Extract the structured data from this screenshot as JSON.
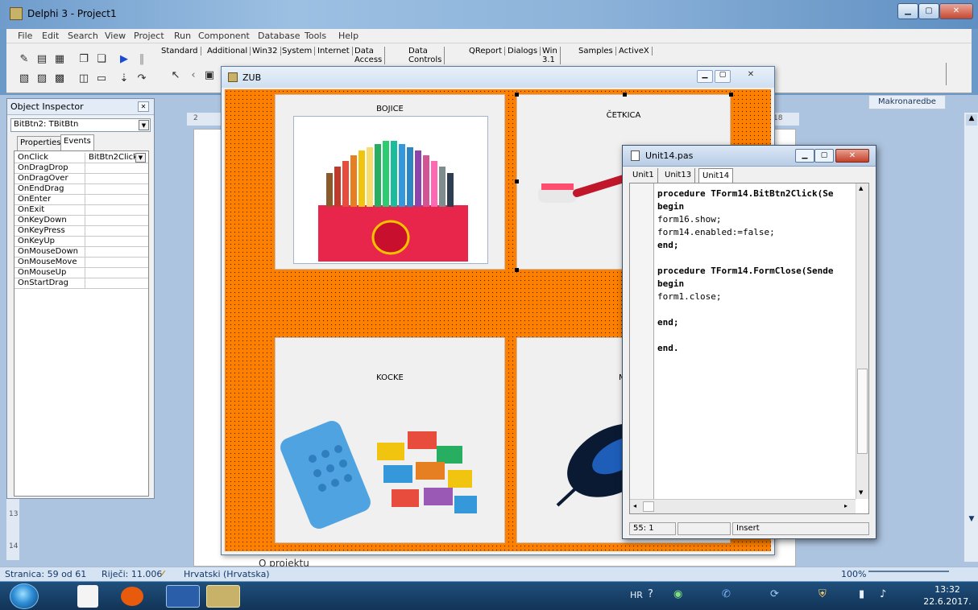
{
  "main_window": {
    "title": "Delphi 3 - Project1",
    "menu": [
      "File",
      "Edit",
      "Search",
      "View",
      "Project",
      "Run",
      "Component",
      "Database",
      "Tools",
      "Help"
    ],
    "palette_tabs": [
      "Standard",
      "Additional",
      "Win32",
      "System",
      "Internet",
      "Data Access",
      "Data Controls",
      "QReport",
      "Dialogs",
      "Win 3.1",
      "Samples",
      "ActiveX"
    ]
  },
  "word": {
    "makro_label": "Makronaredbe",
    "page_text": "O projektu",
    "ruler_left_num": "2",
    "ruler_right_num": "18",
    "ruler_left_vertical": [
      "13",
      "14"
    ],
    "status": {
      "page": "Stranica: 59 od 61",
      "words": "Riječi: 11.006",
      "language": "Hrvatski (Hrvatska)",
      "zoom": "100%"
    }
  },
  "object_inspector": {
    "title": "Object Inspector",
    "component": "BitBtn2: TBitBtn",
    "tabs": [
      "Properties",
      "Events"
    ],
    "active_tab": "Events",
    "events": [
      {
        "name": "OnClick",
        "value": "BitBtn2Click"
      },
      {
        "name": "OnDragDrop",
        "value": ""
      },
      {
        "name": "OnDragOver",
        "value": ""
      },
      {
        "name": "OnEndDrag",
        "value": ""
      },
      {
        "name": "OnEnter",
        "value": ""
      },
      {
        "name": "OnExit",
        "value": ""
      },
      {
        "name": "OnKeyDown",
        "value": ""
      },
      {
        "name": "OnKeyPress",
        "value": ""
      },
      {
        "name": "OnKeyUp",
        "value": ""
      },
      {
        "name": "OnMouseDown",
        "value": ""
      },
      {
        "name": "OnMouseMove",
        "value": ""
      },
      {
        "name": "OnMouseUp",
        "value": ""
      },
      {
        "name": "OnStartDrag",
        "value": ""
      }
    ]
  },
  "zub_form": {
    "title": "ZUB",
    "panels": [
      {
        "caption": "BOJICE"
      },
      {
        "caption": "ČETKICA"
      },
      {
        "caption": "KOCKE"
      },
      {
        "caption": "M"
      }
    ]
  },
  "editor": {
    "title": "Unit14.pas",
    "tabs": [
      "Unit1",
      "Unit13",
      "Unit14"
    ],
    "active_tab": "Unit14",
    "lines": [
      "procedure TForm14.BitBtn2Click(Se",
      "begin",
      "form16.show;",
      "form14.enabled:=false;",
      "end;",
      "",
      "procedure TForm14.FormClose(Sende",
      "begin",
      "form1.close;",
      "",
      "end;",
      "",
      "end."
    ],
    "status": {
      "position": "55:  1",
      "mode": "Insert"
    }
  },
  "taskbar": {
    "lang": "HR",
    "time": "13:32",
    "date": "22.6.2017."
  },
  "colors": {
    "form_bg": "#ff7f00",
    "taskbar": "#123457"
  }
}
